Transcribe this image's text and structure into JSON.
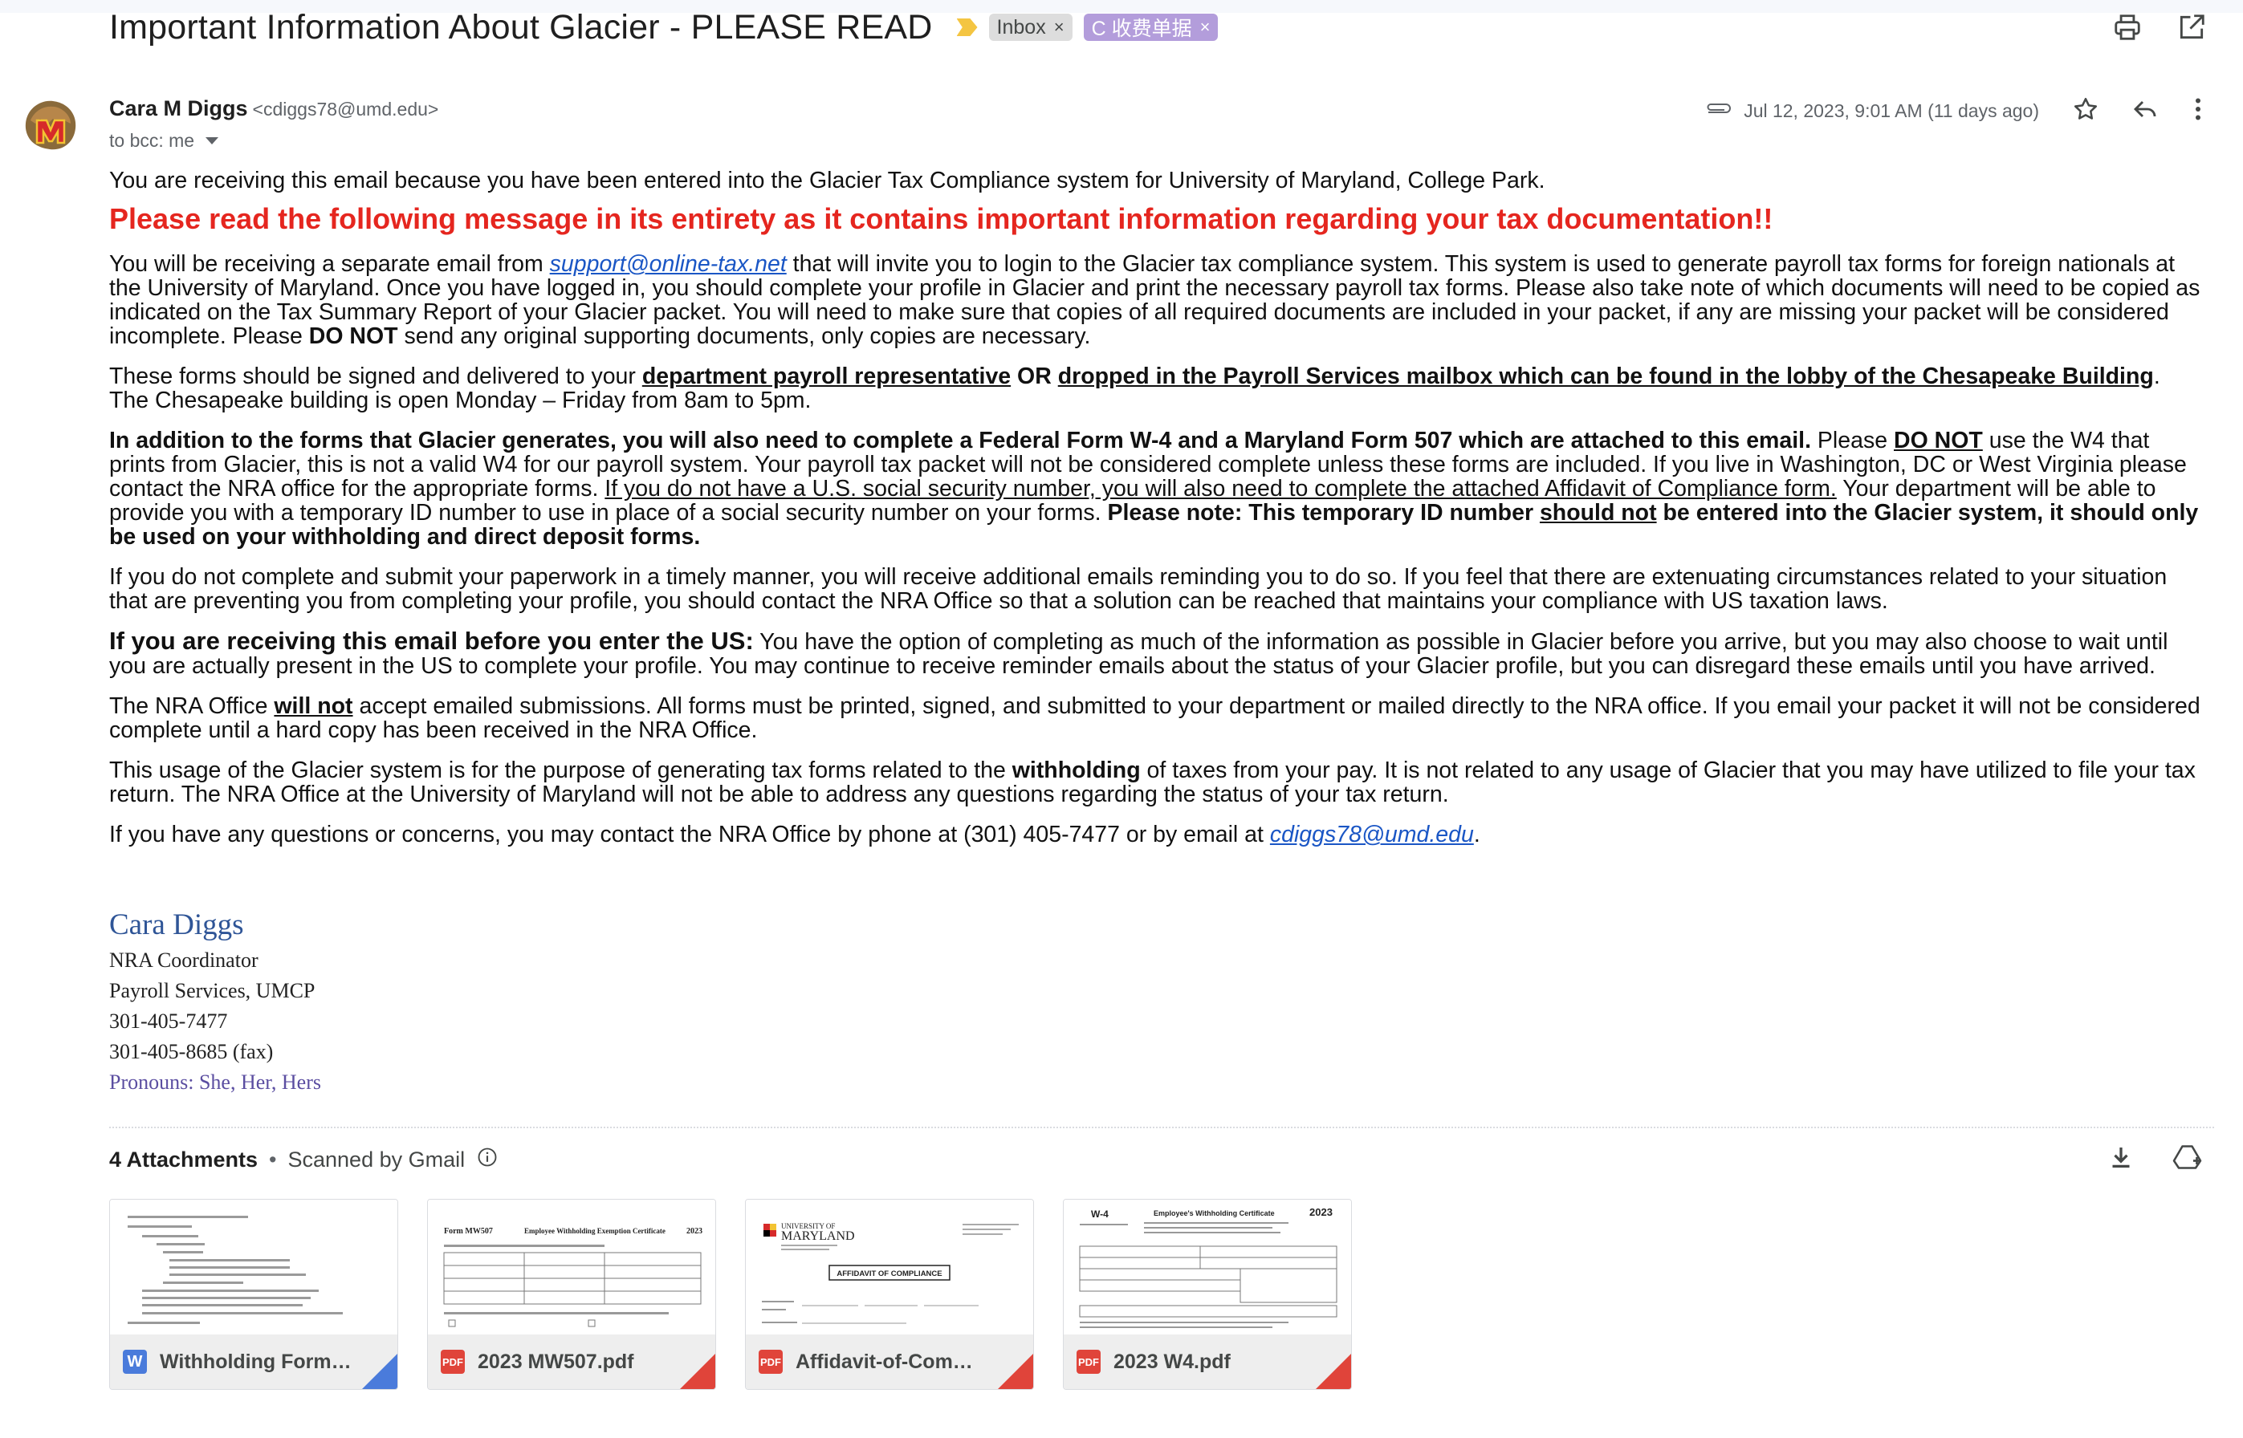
{
  "header": {
    "subject": "Important Information About Glacier - PLEASE READ",
    "labels": [
      {
        "text": "Inbox",
        "remove": "×"
      },
      {
        "text": "C 收费单据",
        "remove": "×"
      }
    ],
    "icons": [
      "print-icon",
      "open-in-new-window-icon"
    ]
  },
  "message": {
    "sender_name": "Cara M Diggs",
    "sender_email": "<cdiggs78@umd.edu>",
    "recipients": "to bcc: me",
    "date": "Jul 12, 2023, 9:01 AM (11 days ago)",
    "icons": [
      "attachment-clip-icon",
      "star-icon",
      "reply-icon",
      "more-vert-icon"
    ]
  },
  "body": {
    "p_intro": "You are receiving this email because you have been entered into the Glacier Tax Compliance system for University of Maryland, College Park.",
    "warning": "Please read the following message in its entirety as it contains important information regarding your tax documentation!!",
    "p1_a": "You will be receiving a separate email from ",
    "p1_link": "support@online-tax.net",
    "p1_b": " that will invite you to login to the Glacier tax compliance system. This system is used to generate payroll tax forms for foreign nationals at the University of Maryland.  Once you have logged in, you should complete your profile in Glacier and print the necessary payroll tax forms.  Please also take note of which documents will need to be copied as indicated on the Tax Summary Report of your Glacier packet.  You will need to make sure that copies of all required documents are included in your packet, if any are missing your packet will be considered incomplete.  Please ",
    "p1_bold": "DO NOT",
    "p1_c": " send any original supporting documents, only copies are necessary.",
    "p2_a": "These forms should be signed and delivered to your ",
    "p2_u1": "department payroll representative",
    "p2_or": " OR ",
    "p2_u2": "dropped in the Payroll Services mailbox which can be found in the lobby of the Chesapeake Building",
    "p2_b": ".  The Chesapeake building is open Monday – Friday from 8am to 5pm.",
    "p3_bold1": "In addition to the forms that Glacier generates, you will also need to complete a Federal Form W-4 and a Maryland Form 507 which are attached to this email.",
    "p3_a": "  Please ",
    "p3_dont": "DO NOT",
    "p3_b": " use the W4 that prints from Glacier, this is not a valid W4 for our payroll system.  Your payroll tax packet will not be considered complete unless these forms are included.  If you live in Washington, DC or West Virginia please contact the NRA office for the appropriate forms.  ",
    "p3_u": "If you do not have a U.S. social security number, you will also need to complete the attached Affidavit of Compliance form.",
    "p3_c": " Your department will be able to provide you with a temporary ID number to use in place of a social security number on your forms. ",
    "p3_bold2": "Please note: This temporary ID number ",
    "p3_should_not": "should not",
    "p3_bold3": " be entered into the Glacier system, it should only be used on your withholding and direct deposit forms.",
    "p4": "If you do not complete and submit your paperwork in a timely manner, you will receive additional emails reminding you to do so.  If you feel that there are extenuating circumstances related to your situation that are preventing you from completing your profile, you should contact the NRA Office so that a solution can be reached that maintains your compliance with US taxation laws.",
    "p5_bold": "If you are receiving this email before you enter the US:",
    "p5_a": "  You have the option of completing as much of the information as possible in Glacier before you arrive, but you may also choose to wait until you are actually present in the US to complete your profile.  You may continue to receive reminder emails about the status of your Glacier profile, but you can disregard these emails until you have arrived.",
    "p6_a": "The NRA Office ",
    "p6_u": "will not",
    "p6_b": " accept emailed submissions.  All forms must be printed, signed, and submitted to your department or mailed directly to the NRA office.  If you email your packet it will not be considered complete until a hard copy has been received in the NRA Office.",
    "p7_a": "This usage of the Glacier system is for the purpose of generating tax forms related to the ",
    "p7_bold": "withholding",
    "p7_b": " of taxes from your pay.  It is not related to any usage of Glacier that you may have utilized to file your tax return.  The NRA Office at the University of Maryland will not be able to address any questions regarding the status of your tax return.",
    "p8_a": "If you have any questions or concerns, you may contact the NRA Office by phone at (301) 405-7477 or by email at ",
    "p8_link": "cdiggs78@umd.edu",
    "p8_b": "."
  },
  "signature": {
    "name": "Cara Diggs",
    "title": "NRA Coordinator",
    "dept": "Payroll Services, UMCP",
    "phone": "301-405-7477",
    "fax": "301-405-8685 (fax)",
    "pronouns": "Pronouns: She, Her, Hers"
  },
  "attachments": {
    "count_label": "4 Attachments",
    "dot": "•",
    "scanned": "Scanned by Gmail",
    "items": [
      {
        "name": "Withholding Form…",
        "type": "W",
        "color": "#4a7bdb"
      },
      {
        "name": "2023 MW507.pdf",
        "type": "PDF",
        "color": "#e0443a"
      },
      {
        "name": "Affidavit-of-Com…",
        "type": "PDF",
        "color": "#e0443a"
      },
      {
        "name": "2023 W4.pdf",
        "type": "PDF",
        "color": "#e0443a"
      }
    ],
    "thumbs": {
      "mw507_form": "Form MW507",
      "mw507_title": "Employee Withholding Exemption Certificate",
      "mw507_year": "2023",
      "umd_top": "UNIVERSITY OF",
      "umd_bottom": "MARYLAND",
      "affidavit_title": "AFFIDAVIT OF COMPLIANCE",
      "w4_form": "W-4",
      "w4_title": "Employee's Withholding Certificate",
      "w4_year": "2023"
    },
    "actions": [
      "download-all-icon",
      "add-to-drive-icon"
    ]
  }
}
